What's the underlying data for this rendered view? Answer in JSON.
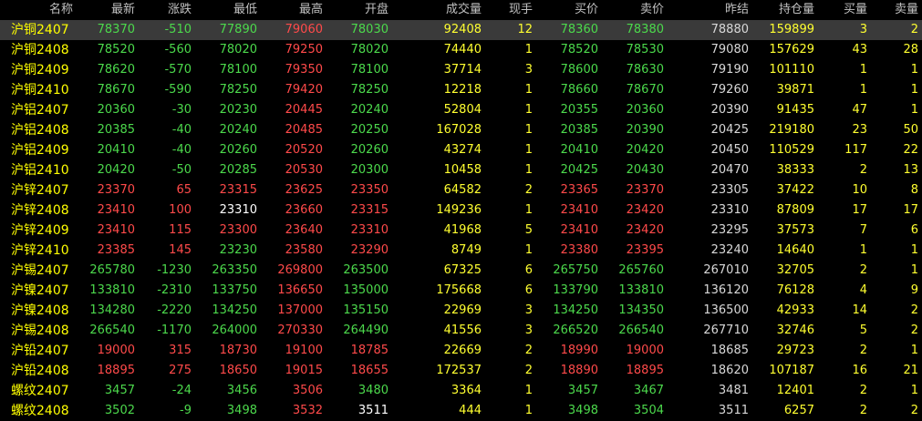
{
  "colors": {
    "background": "#000000",
    "header_text": "#c0c0c0",
    "up": "#ff4a4a",
    "down": "#4cd94c",
    "flat": "#ffffff",
    "volume": "#ffff30",
    "name": "#ffff00",
    "selected_row": "#3a3a3a"
  },
  "headers": [
    "名称",
    "最新",
    "涨跌",
    "最低",
    "最高",
    "开盘",
    "成交量",
    "现手",
    "买价",
    "卖价",
    "昨结",
    "持仓量",
    "买量",
    "卖量"
  ],
  "rows": [
    {
      "name": "沪铜2407",
      "latest": "78370",
      "change": "-510",
      "low": "77890",
      "high": "79060",
      "open": "78030",
      "volume": "92408",
      "last_vol": "12",
      "bid": "78360",
      "ask": "78380",
      "prev_settle": "78880",
      "open_interest": "159899",
      "bid_vol": "3",
      "ask_vol": "2",
      "dir": {
        "latest": "down",
        "change": "down",
        "low": "down",
        "high": "up",
        "open": "down",
        "bid": "down",
        "ask": "down"
      }
    },
    {
      "name": "沪铜2408",
      "latest": "78520",
      "change": "-560",
      "low": "78020",
      "high": "79250",
      "open": "78020",
      "volume": "74440",
      "last_vol": "1",
      "bid": "78520",
      "ask": "78530",
      "prev_settle": "79080",
      "open_interest": "157629",
      "bid_vol": "43",
      "ask_vol": "28",
      "dir": {
        "latest": "down",
        "change": "down",
        "low": "down",
        "high": "up",
        "open": "down",
        "bid": "down",
        "ask": "down"
      }
    },
    {
      "name": "沪铜2409",
      "latest": "78620",
      "change": "-570",
      "low": "78100",
      "high": "79350",
      "open": "78100",
      "volume": "37714",
      "last_vol": "3",
      "bid": "78600",
      "ask": "78630",
      "prev_settle": "79190",
      "open_interest": "101110",
      "bid_vol": "1",
      "ask_vol": "1",
      "dir": {
        "latest": "down",
        "change": "down",
        "low": "down",
        "high": "up",
        "open": "down",
        "bid": "down",
        "ask": "down"
      }
    },
    {
      "name": "沪铜2410",
      "latest": "78670",
      "change": "-590",
      "low": "78250",
      "high": "79420",
      "open": "78250",
      "volume": "12218",
      "last_vol": "1",
      "bid": "78660",
      "ask": "78670",
      "prev_settle": "79260",
      "open_interest": "39871",
      "bid_vol": "1",
      "ask_vol": "1",
      "dir": {
        "latest": "down",
        "change": "down",
        "low": "down",
        "high": "up",
        "open": "down",
        "bid": "down",
        "ask": "down"
      }
    },
    {
      "name": "沪铝2407",
      "latest": "20360",
      "change": "-30",
      "low": "20230",
      "high": "20445",
      "open": "20240",
      "volume": "52804",
      "last_vol": "1",
      "bid": "20355",
      "ask": "20360",
      "prev_settle": "20390",
      "open_interest": "91435",
      "bid_vol": "47",
      "ask_vol": "1",
      "dir": {
        "latest": "down",
        "change": "down",
        "low": "down",
        "high": "up",
        "open": "down",
        "bid": "down",
        "ask": "down"
      }
    },
    {
      "name": "沪铝2408",
      "latest": "20385",
      "change": "-40",
      "low": "20240",
      "high": "20485",
      "open": "20250",
      "volume": "167028",
      "last_vol": "1",
      "bid": "20385",
      "ask": "20390",
      "prev_settle": "20425",
      "open_interest": "219180",
      "bid_vol": "23",
      "ask_vol": "50",
      "dir": {
        "latest": "down",
        "change": "down",
        "low": "down",
        "high": "up",
        "open": "down",
        "bid": "down",
        "ask": "down"
      }
    },
    {
      "name": "沪铝2409",
      "latest": "20410",
      "change": "-40",
      "low": "20260",
      "high": "20520",
      "open": "20260",
      "volume": "43274",
      "last_vol": "1",
      "bid": "20410",
      "ask": "20420",
      "prev_settle": "20450",
      "open_interest": "110529",
      "bid_vol": "117",
      "ask_vol": "22",
      "dir": {
        "latest": "down",
        "change": "down",
        "low": "down",
        "high": "up",
        "open": "down",
        "bid": "down",
        "ask": "down"
      }
    },
    {
      "name": "沪铝2410",
      "latest": "20420",
      "change": "-50",
      "low": "20285",
      "high": "20530",
      "open": "20300",
      "volume": "10458",
      "last_vol": "1",
      "bid": "20425",
      "ask": "20430",
      "prev_settle": "20470",
      "open_interest": "38333",
      "bid_vol": "2",
      "ask_vol": "13",
      "dir": {
        "latest": "down",
        "change": "down",
        "low": "down",
        "high": "up",
        "open": "down",
        "bid": "down",
        "ask": "down"
      }
    },
    {
      "name": "沪锌2407",
      "latest": "23370",
      "change": "65",
      "low": "23315",
      "high": "23625",
      "open": "23350",
      "volume": "64582",
      "last_vol": "2",
      "bid": "23365",
      "ask": "23370",
      "prev_settle": "23305",
      "open_interest": "37422",
      "bid_vol": "10",
      "ask_vol": "8",
      "dir": {
        "latest": "up",
        "change": "up",
        "low": "up",
        "high": "up",
        "open": "up",
        "bid": "up",
        "ask": "up"
      }
    },
    {
      "name": "沪锌2408",
      "latest": "23410",
      "change": "100",
      "low": "23310",
      "high": "23660",
      "open": "23315",
      "volume": "149236",
      "last_vol": "1",
      "bid": "23410",
      "ask": "23420",
      "prev_settle": "23310",
      "open_interest": "87809",
      "bid_vol": "17",
      "ask_vol": "17",
      "dir": {
        "latest": "up",
        "change": "up",
        "low": "flat",
        "high": "up",
        "open": "up",
        "bid": "up",
        "ask": "up"
      }
    },
    {
      "name": "沪锌2409",
      "latest": "23410",
      "change": "115",
      "low": "23300",
      "high": "23640",
      "open": "23310",
      "volume": "41968",
      "last_vol": "5",
      "bid": "23410",
      "ask": "23420",
      "prev_settle": "23295",
      "open_interest": "37573",
      "bid_vol": "7",
      "ask_vol": "6",
      "dir": {
        "latest": "up",
        "change": "up",
        "low": "up",
        "high": "up",
        "open": "up",
        "bid": "up",
        "ask": "up"
      }
    },
    {
      "name": "沪锌2410",
      "latest": "23385",
      "change": "145",
      "low": "23230",
      "high": "23580",
      "open": "23290",
      "volume": "8749",
      "last_vol": "1",
      "bid": "23380",
      "ask": "23395",
      "prev_settle": "23240",
      "open_interest": "14640",
      "bid_vol": "1",
      "ask_vol": "1",
      "dir": {
        "latest": "up",
        "change": "up",
        "low": "down",
        "high": "up",
        "open": "up",
        "bid": "up",
        "ask": "up"
      }
    },
    {
      "name": "沪锡2407",
      "latest": "265780",
      "change": "-1230",
      "low": "263350",
      "high": "269800",
      "open": "263500",
      "volume": "67325",
      "last_vol": "6",
      "bid": "265750",
      "ask": "265760",
      "prev_settle": "267010",
      "open_interest": "32705",
      "bid_vol": "2",
      "ask_vol": "1",
      "dir": {
        "latest": "down",
        "change": "down",
        "low": "down",
        "high": "up",
        "open": "down",
        "bid": "down",
        "ask": "down"
      }
    },
    {
      "name": "沪镍2407",
      "latest": "133810",
      "change": "-2310",
      "low": "133750",
      "high": "136650",
      "open": "135000",
      "volume": "175668",
      "last_vol": "6",
      "bid": "133790",
      "ask": "133810",
      "prev_settle": "136120",
      "open_interest": "76128",
      "bid_vol": "4",
      "ask_vol": "9",
      "dir": {
        "latest": "down",
        "change": "down",
        "low": "down",
        "high": "up",
        "open": "down",
        "bid": "down",
        "ask": "down"
      }
    },
    {
      "name": "沪镍2408",
      "latest": "134280",
      "change": "-2220",
      "low": "134250",
      "high": "137000",
      "open": "135150",
      "volume": "22969",
      "last_vol": "3",
      "bid": "134250",
      "ask": "134350",
      "prev_settle": "136500",
      "open_interest": "42933",
      "bid_vol": "14",
      "ask_vol": "2",
      "dir": {
        "latest": "down",
        "change": "down",
        "low": "down",
        "high": "up",
        "open": "down",
        "bid": "down",
        "ask": "down"
      }
    },
    {
      "name": "沪锡2408",
      "latest": "266540",
      "change": "-1170",
      "low": "264000",
      "high": "270330",
      "open": "264490",
      "volume": "41556",
      "last_vol": "3",
      "bid": "266520",
      "ask": "266540",
      "prev_settle": "267710",
      "open_interest": "32746",
      "bid_vol": "5",
      "ask_vol": "2",
      "dir": {
        "latest": "down",
        "change": "down",
        "low": "down",
        "high": "up",
        "open": "down",
        "bid": "down",
        "ask": "down"
      }
    },
    {
      "name": "沪铅2407",
      "latest": "19000",
      "change": "315",
      "low": "18730",
      "high": "19100",
      "open": "18785",
      "volume": "22669",
      "last_vol": "2",
      "bid": "18990",
      "ask": "19000",
      "prev_settle": "18685",
      "open_interest": "29723",
      "bid_vol": "2",
      "ask_vol": "1",
      "dir": {
        "latest": "up",
        "change": "up",
        "low": "up",
        "high": "up",
        "open": "up",
        "bid": "up",
        "ask": "up"
      }
    },
    {
      "name": "沪铅2408",
      "latest": "18895",
      "change": "275",
      "low": "18650",
      "high": "19015",
      "open": "18655",
      "volume": "172537",
      "last_vol": "2",
      "bid": "18890",
      "ask": "18895",
      "prev_settle": "18620",
      "open_interest": "107187",
      "bid_vol": "16",
      "ask_vol": "21",
      "dir": {
        "latest": "up",
        "change": "up",
        "low": "up",
        "high": "up",
        "open": "up",
        "bid": "up",
        "ask": "up"
      }
    },
    {
      "name": "螺纹2407",
      "latest": "3457",
      "change": "-24",
      "low": "3456",
      "high": "3506",
      "open": "3480",
      "volume": "3364",
      "last_vol": "1",
      "bid": "3457",
      "ask": "3467",
      "prev_settle": "3481",
      "open_interest": "12401",
      "bid_vol": "2",
      "ask_vol": "1",
      "dir": {
        "latest": "down",
        "change": "down",
        "low": "down",
        "high": "up",
        "open": "down",
        "bid": "down",
        "ask": "down"
      }
    },
    {
      "name": "螺纹2408",
      "latest": "3502",
      "change": "-9",
      "low": "3498",
      "high": "3532",
      "open": "3511",
      "volume": "444",
      "last_vol": "1",
      "bid": "3498",
      "ask": "3504",
      "prev_settle": "3511",
      "open_interest": "6257",
      "bid_vol": "2",
      "ask_vol": "2",
      "dir": {
        "latest": "down",
        "change": "down",
        "low": "down",
        "high": "up",
        "open": "flat",
        "bid": "down",
        "ask": "down"
      }
    }
  ],
  "selected_row_index": 0
}
